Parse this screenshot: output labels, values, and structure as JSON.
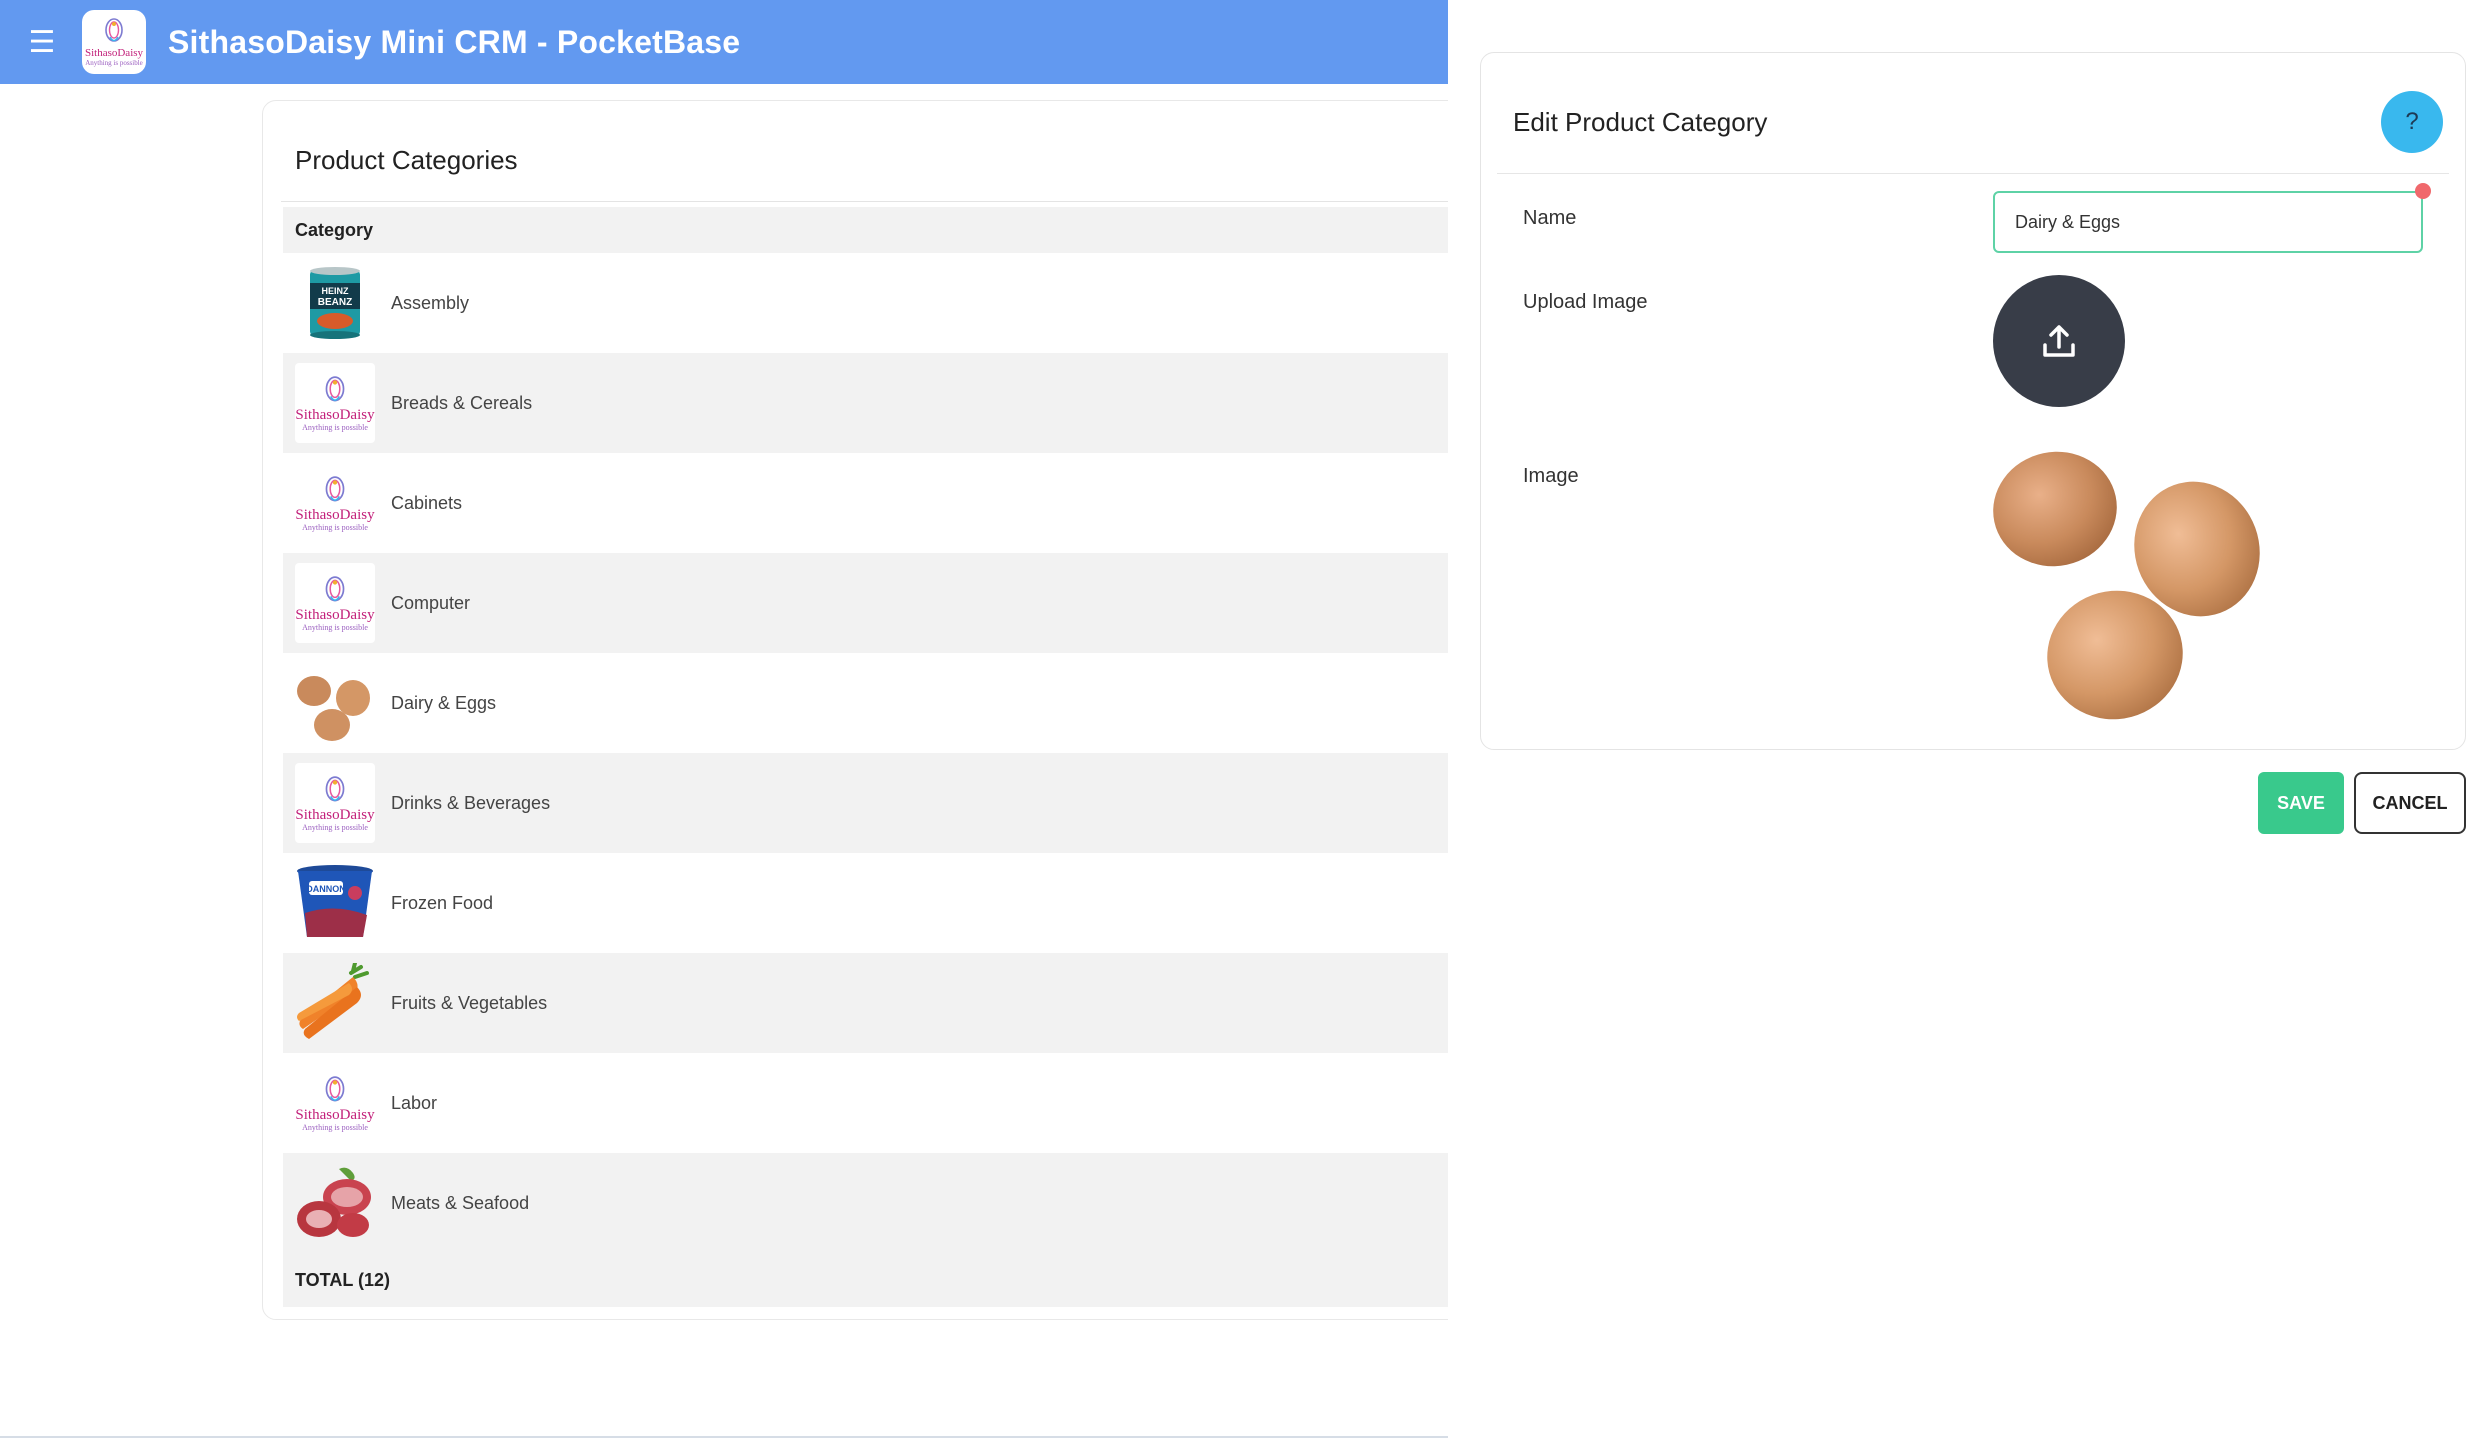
{
  "header": {
    "menu_icon": "hamburger-menu-icon",
    "title": "SithasoDaisy Mini CRM - PocketBase",
    "logo": {
      "brand": "SithasoDaisy",
      "tagline": "Anything is possible"
    }
  },
  "list": {
    "title": "Product Categories",
    "column_header": "Category",
    "rows": [
      {
        "label": "Assembly",
        "image": "beans-can"
      },
      {
        "label": "Breads & Cereals",
        "image": "sithasodaisy-logo"
      },
      {
        "label": "Cabinets",
        "image": "sithasodaisy-logo"
      },
      {
        "label": "Computer",
        "image": "sithasodaisy-logo"
      },
      {
        "label": "Dairy & Eggs",
        "image": "eggs"
      },
      {
        "label": "Drinks & Beverages",
        "image": "sithasodaisy-logo"
      },
      {
        "label": "Frozen Food",
        "image": "yogurt-cup"
      },
      {
        "label": "Fruits & Vegetables",
        "image": "carrots"
      },
      {
        "label": "Labor",
        "image": "sithasodaisy-logo"
      },
      {
        "label": "Meats & Seafood",
        "image": "meat"
      }
    ],
    "footer": "TOTAL (12)"
  },
  "edit_panel": {
    "title": "Edit Product Category",
    "help_label": "?",
    "name_label": "Name",
    "name_value": "Dairy & Eggs",
    "upload_label": "Upload Image",
    "upload_icon": "upload-icon",
    "image_label": "Image",
    "save_label": "SAVE",
    "cancel_label": "CANCEL"
  },
  "colors": {
    "topbar": "#6299f0",
    "help_button": "#39b8ee",
    "save_button": "#39c98c",
    "upload_button": "#383d48",
    "input_border": "#5ed2a6",
    "required_dot": "#f0686c"
  }
}
